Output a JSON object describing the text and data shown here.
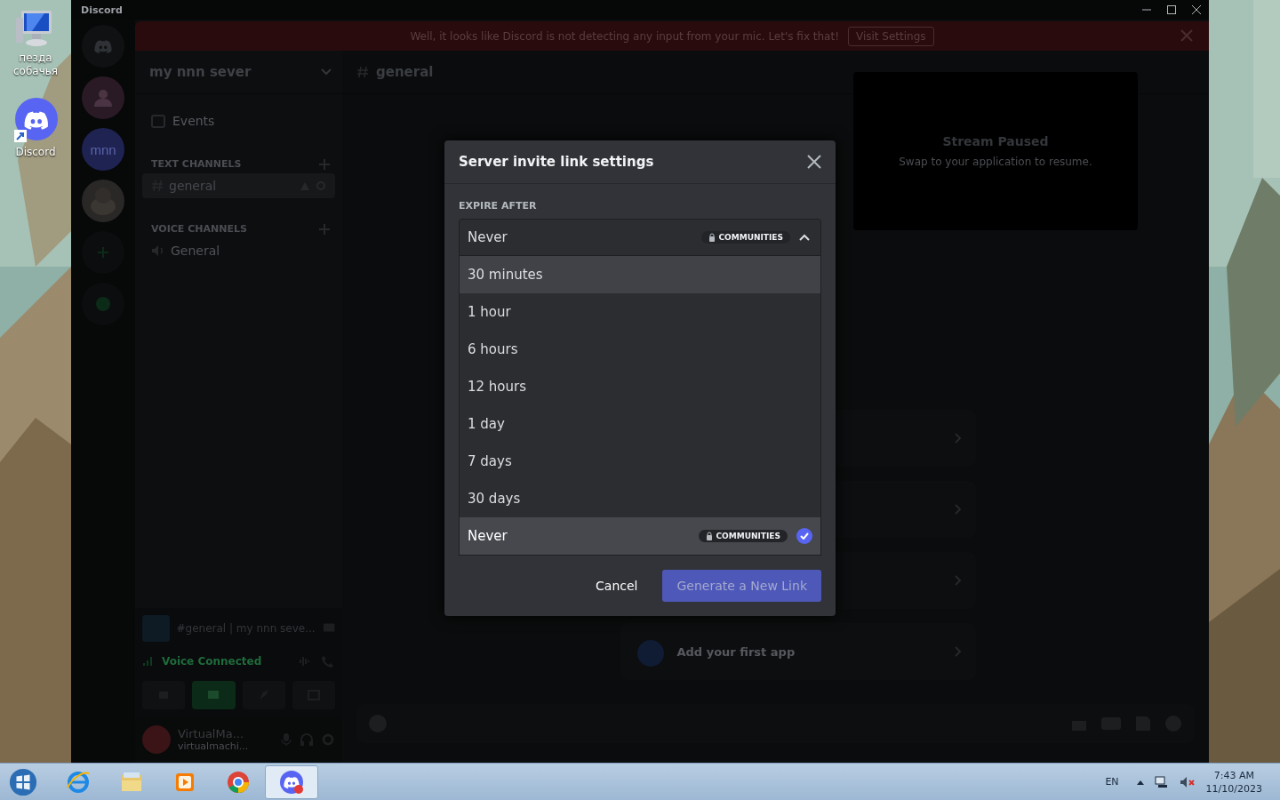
{
  "desktop": {
    "icons": [
      {
        "kind": "computer",
        "label": "пезда собачья"
      },
      {
        "kind": "discord",
        "label": "Discord"
      }
    ]
  },
  "window": {
    "title": "Discord"
  },
  "banner": {
    "message": "Well, it looks like Discord is not detecting any input from your mic. Let's fix that!",
    "action": "Visit Settings"
  },
  "server_rail": {
    "items": [
      {
        "kind": "home"
      },
      {
        "kind": "group"
      },
      {
        "kind": "text",
        "label": "mnn"
      },
      {
        "kind": "avatar"
      },
      {
        "kind": "add"
      },
      {
        "kind": "explore"
      }
    ]
  },
  "channel_sidebar": {
    "server_name": "my nnn sever",
    "events": "Events",
    "categories": [
      {
        "name": "TEXT CHANNELS",
        "channels": [
          {
            "kind": "text",
            "name": "general",
            "selected": true
          }
        ]
      },
      {
        "name": "VOICE CHANNELS",
        "channels": [
          {
            "kind": "voice",
            "name": "General",
            "selected": false
          }
        ]
      }
    ]
  },
  "voice_panel": {
    "stream_title": "#general | my nnn seve...",
    "status": "Voice Connected"
  },
  "user_panel": {
    "name": "VirtualMa...",
    "tag": "virtualmachi..."
  },
  "channel_header": {
    "name": "general"
  },
  "stream": {
    "title": "Stream Paused",
    "subtitle": "Swap to your application to resume."
  },
  "onboarding": {
    "last_card": "Add your first app"
  },
  "modal": {
    "title": "Server invite link settings",
    "section_label": "EXPIRE AFTER",
    "select": {
      "value": "Never",
      "badge": "COMMUNITIES",
      "expanded": true
    },
    "options": [
      {
        "label": "30 minutes",
        "selected": false,
        "hovered": true
      },
      {
        "label": "1 hour",
        "selected": false,
        "hovered": false
      },
      {
        "label": "6 hours",
        "selected": false,
        "hovered": false
      },
      {
        "label": "12 hours",
        "selected": false,
        "hovered": false
      },
      {
        "label": "1 day",
        "selected": false,
        "hovered": false
      },
      {
        "label": "7 days",
        "selected": false,
        "hovered": false
      },
      {
        "label": "30 days",
        "selected": false,
        "hovered": false
      },
      {
        "label": "Never",
        "badge": "COMMUNITIES",
        "selected": true,
        "hovered": false
      }
    ],
    "buttons": [
      {
        "kind": "link",
        "label": "Cancel"
      },
      {
        "kind": "primary",
        "label": "Generate a New Link"
      }
    ]
  },
  "taskbar": {
    "apps": [
      {
        "kind": "ie",
        "selected": false
      },
      {
        "kind": "explorer",
        "selected": false
      },
      {
        "kind": "media",
        "selected": false
      },
      {
        "kind": "chrome",
        "selected": false
      },
      {
        "kind": "discord",
        "selected": true
      }
    ],
    "language": "EN",
    "time": "7:43 AM",
    "date": "11/10/2023"
  }
}
